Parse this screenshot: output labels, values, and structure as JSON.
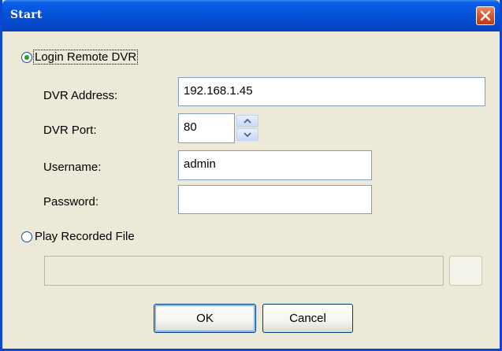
{
  "window": {
    "title": "Start"
  },
  "login_remote": {
    "label": "Login Remote DVR",
    "selected": true,
    "fields": {
      "address_label": "DVR Address:",
      "address_value": "192.168.1.45",
      "port_label": "DVR Port:",
      "port_value": "80",
      "username_label": "Username:",
      "username_value": "admin",
      "password_label": "Password:",
      "password_value": ""
    }
  },
  "play_recorded": {
    "label": "Play Recorded File",
    "selected": false,
    "file_path": ""
  },
  "buttons": {
    "ok": "OK",
    "cancel": "Cancel"
  },
  "icons": {
    "close": "close-icon",
    "spin_up": "chevron-up-icon",
    "spin_down": "chevron-down-icon"
  },
  "colors": {
    "titlebar": "#0552d9",
    "close_button": "#d9532f",
    "dialog_background": "#ece9d8",
    "radio_selected": "#21a121"
  }
}
